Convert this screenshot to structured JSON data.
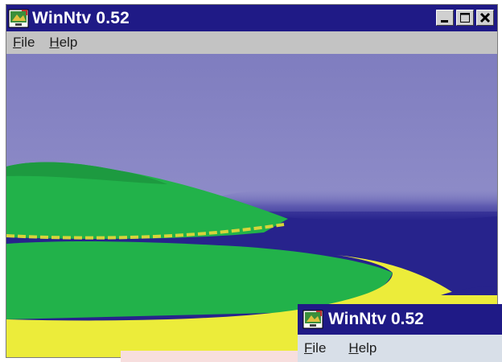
{
  "window": {
    "title": "WinNtv 0.52",
    "controls": [
      "minimize",
      "maximize",
      "close"
    ]
  },
  "menu": {
    "file_prefix": "F",
    "file_rest": "ile",
    "help_prefix": "H",
    "help_rest": "elp"
  },
  "secondary_window": {
    "title": "WinNtv 0.52",
    "file_prefix": "F",
    "file_rest": "ile",
    "help_prefix": "H",
    "help_rest": "elp"
  },
  "colors": {
    "titlebar": "#1f1a86",
    "sky": "#8a88c6",
    "sea": "#27238c",
    "grass": "#22b24a",
    "sand": "#ecec3a"
  },
  "icons": [
    "app-icon",
    "minimize-icon",
    "maximize-icon",
    "close-icon"
  ]
}
